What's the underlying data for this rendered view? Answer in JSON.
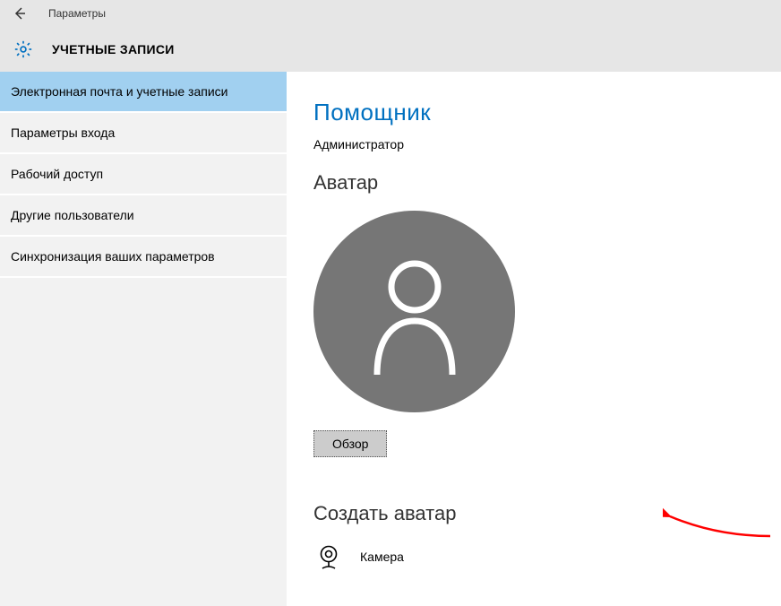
{
  "titlebar": {
    "label": "Параметры"
  },
  "header": {
    "title": "УЧЕТНЫЕ ЗАПИСИ"
  },
  "sidebar": {
    "items": [
      {
        "label": "Электронная почта и учетные записи",
        "selected": true
      },
      {
        "label": "Параметры входа",
        "selected": false
      },
      {
        "label": "Рабочий доступ",
        "selected": false
      },
      {
        "label": "Другие пользователи",
        "selected": false
      },
      {
        "label": "Синхронизация ваших параметров",
        "selected": false
      }
    ]
  },
  "main": {
    "username": "Помощник",
    "role": "Администратор",
    "avatar_section": "Аватар",
    "browse_label": "Обзор",
    "create_avatar_section": "Создать аватар",
    "camera_label": "Камера"
  },
  "colors": {
    "accent": "#0070c0",
    "sidebar_selected": "#a1d0f0",
    "avatar_bg": "#767676"
  }
}
